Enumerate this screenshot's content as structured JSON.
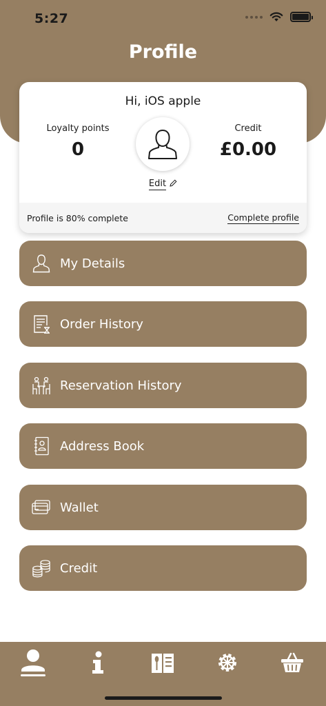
{
  "status": {
    "time": "5:27"
  },
  "header": {
    "title": "Profile"
  },
  "profile": {
    "greeting": "Hi, iOS apple",
    "loyalty_label": "Loyalty points",
    "loyalty_value": "0",
    "credit_label": "Credit",
    "credit_value": "£0.00",
    "edit_label": "Edit",
    "completion_text": "Profile is 80% complete",
    "completion_fraction": 0.8,
    "complete_link": "Complete profile"
  },
  "menu": [
    {
      "label": "My Details",
      "icon": "person-icon"
    },
    {
      "label": "Order History",
      "icon": "receipt-icon"
    },
    {
      "label": "Reservation History",
      "icon": "dining-table-icon"
    },
    {
      "label": "Address Book",
      "icon": "address-book-icon"
    },
    {
      "label": "Wallet",
      "icon": "card-icon"
    },
    {
      "label": "Credit",
      "icon": "coins-icon"
    }
  ],
  "tabs": [
    {
      "icon": "profile-tab-icon",
      "active": true
    },
    {
      "icon": "info-tab-icon",
      "active": false
    },
    {
      "icon": "menu-book-tab-icon",
      "active": false
    },
    {
      "icon": "settings-tab-icon",
      "active": false
    },
    {
      "icon": "basket-tab-icon",
      "active": false
    }
  ],
  "colors": {
    "brand": "#967f62",
    "card": "#ffffff",
    "footer": "#f5f5f5",
    "text": "#1a1a1a"
  }
}
